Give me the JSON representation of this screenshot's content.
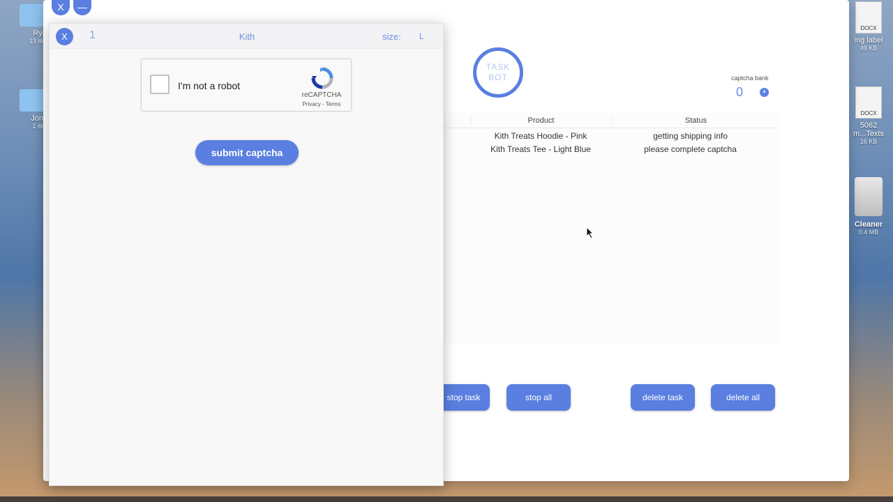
{
  "desktop": {
    "items": [
      {
        "name": "Rya",
        "sub": "13 ite"
      },
      {
        "name": "Jord",
        "sub": "1 ite"
      },
      {
        "badge": "DOCX"
      },
      {
        "name": "ing label",
        "sub": "49 KB"
      },
      {
        "badge": "DOCX"
      },
      {
        "name": "5062",
        "sub": "m...Texts"
      },
      {
        "name": "",
        "sub": "16 KB"
      },
      {
        "name": "Cleaner",
        "sub": "0.4 MB"
      }
    ]
  },
  "main_window": {
    "close_label": "X",
    "minimize_label": "—",
    "logo": {
      "line1": "TASK",
      "line2": "BOT"
    },
    "captcha_bank": {
      "label": "captcha bank",
      "count": "0",
      "add_label": "+"
    },
    "table": {
      "columns": [
        "Product",
        "Status"
      ],
      "rows": [
        {
          "product": "Kith Treats Hoodie - Pink",
          "status": "getting shipping info"
        },
        {
          "product": "Kith Treats Tee - Light Blue",
          "status": "please complete captcha"
        }
      ]
    },
    "buttons": {
      "stop_task": "stop task",
      "stop_all": "stop all",
      "delete_task": "delete task",
      "delete_all": "delete all"
    }
  },
  "captcha_window": {
    "close_label": "X",
    "task_number": "1",
    "store": "Kith",
    "size_label": "size:",
    "size_value": "L",
    "recaptcha": {
      "label": "I'm not a robot",
      "brand": "reCAPTCHA",
      "links": "Privacy - Terms"
    },
    "submit_label": "submit captcha"
  }
}
